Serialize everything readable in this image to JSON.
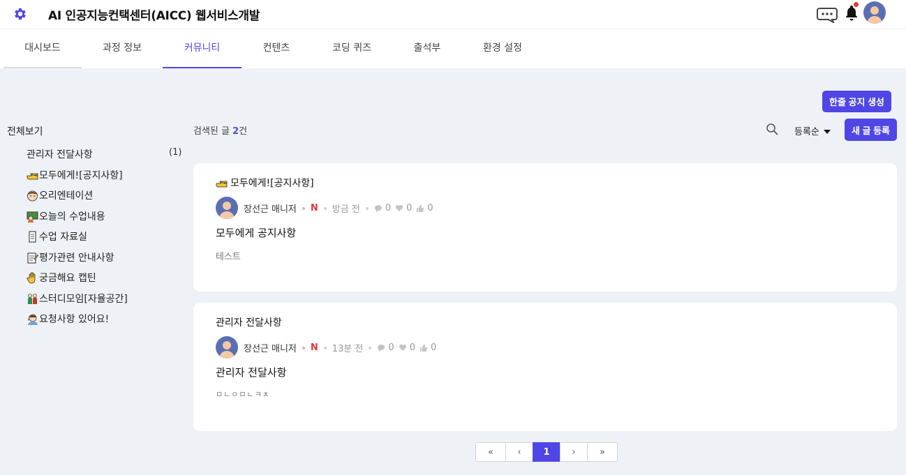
{
  "header": {
    "title": "AI 인공지능컨택센터(AICC) 웹서비스개발"
  },
  "tabs": [
    "대시보드",
    "과정 정보",
    "커뮤니티",
    "컨텐츠",
    "코딩 퀴즈",
    "출석부",
    "환경 설정"
  ],
  "active_tab": "커뮤니티",
  "colors": {
    "accent": "#4f46e5",
    "badge_red": "#e53935"
  },
  "sidebar": {
    "all_label": "전체보기",
    "items": [
      {
        "label": "관리자 전달사항",
        "count": "(1)",
        "icon": ""
      },
      {
        "label": "모두에게![공지사항]",
        "icon": "pointing-hand-icon"
      },
      {
        "label": "오리엔테이션",
        "icon": "student-face-icon"
      },
      {
        "label": "오늘의 수업내용",
        "icon": "teacher-board-icon"
      },
      {
        "label": "수업 자료실",
        "icon": "scroll-icon"
      },
      {
        "label": "평가관련 안내사항",
        "icon": "memo-icon"
      },
      {
        "label": "궁금해요 캡틴",
        "icon": "raised-hand-icon"
      },
      {
        "label": "스터디모임[자율공간]",
        "icon": "people-icon"
      },
      {
        "label": "요청사항 있어요!",
        "icon": "asking-person-icon"
      }
    ]
  },
  "actions": {
    "notice_button": "한줄 공지 생성",
    "result_prefix": "검색된 글 ",
    "result_count": "2",
    "result_suffix": "건",
    "sort_label": "등록순",
    "new_post_button": "새 글 등록"
  },
  "posts": [
    {
      "board": "모두에게![공지사항]",
      "board_icon": "pointing-hand-icon",
      "author": "장선근 매니저",
      "badge": "N",
      "time": "방금 전",
      "comments": "0",
      "likes": "0",
      "thumbs": "0",
      "title": "모두에게 공지사항",
      "body": "테스트"
    },
    {
      "board": "관리자 전달사항",
      "board_icon": "",
      "author": "장선근 매니저",
      "badge": "N",
      "time": "13분 전",
      "comments": "0",
      "likes": "0",
      "thumbs": "0",
      "title": "관리자 전달사항",
      "body": "ㅁㄴㅇㅁㄴㅋㅊ"
    }
  ],
  "pagination": {
    "first": "«",
    "prev": "‹",
    "current": "1",
    "next": "›",
    "last": "»"
  }
}
